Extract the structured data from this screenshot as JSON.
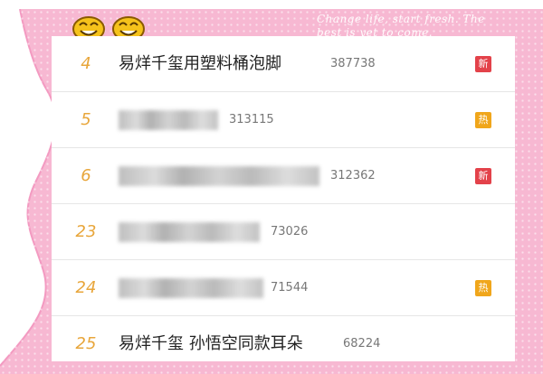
{
  "background": {
    "script_text": "Change life, start fresh. The best is yet to come.",
    "pink": "#f7b8d2",
    "pink_edge": "#f39ac1"
  },
  "hot_list": [
    {
      "rank": "4",
      "title": "易烊千玺用塑料桶泡脚",
      "title_visible": true,
      "count": "387738",
      "badge": "新",
      "badge_type": "new"
    },
    {
      "rank": "5",
      "title": "",
      "title_visible": false,
      "count": "313115",
      "badge": "热",
      "badge_type": "hot"
    },
    {
      "rank": "6",
      "title": "",
      "title_visible": false,
      "count": "312362",
      "badge": "新",
      "badge_type": "new"
    },
    {
      "rank": "23",
      "title": "",
      "title_visible": false,
      "count": "73026",
      "badge": "",
      "badge_type": "none"
    },
    {
      "rank": "24",
      "title": "",
      "title_visible": false,
      "count": "71544",
      "badge": "热",
      "badge_type": "hot"
    },
    {
      "rank": "25",
      "title": "易烊千玺 孙悟空同款耳朵",
      "title_visible": true,
      "count": "68224",
      "badge": "",
      "badge_type": "none"
    }
  ],
  "colors": {
    "rank": "#e8a63b",
    "badge_new": "#e3424a",
    "badge_hot": "#f0a61b"
  }
}
